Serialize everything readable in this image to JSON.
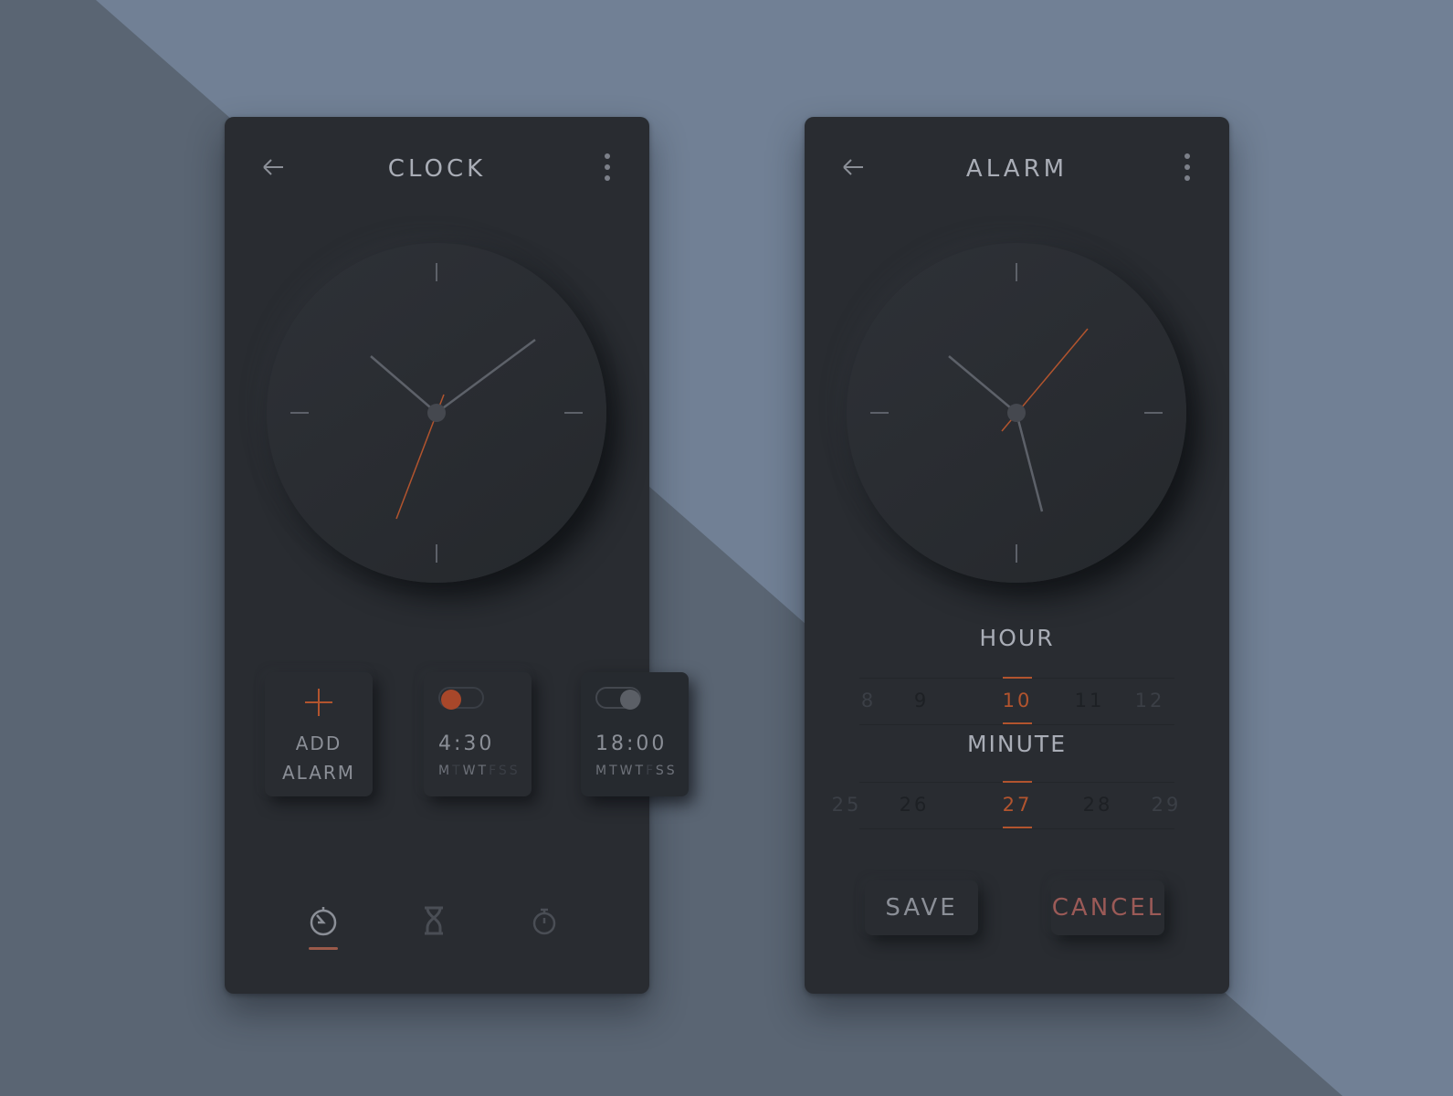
{
  "colors": {
    "background_dark": "#5a6573",
    "background_light": "#718095",
    "panel": "#292c31",
    "accent": "#b2542e",
    "text": "#a9adb6"
  },
  "clock_screen": {
    "title": "CLOCK",
    "back_icon": "arrow-left-icon",
    "menu_icon": "more-vertical-icon",
    "add_alarm": {
      "icon": "plus-icon",
      "line1": "ADD",
      "line2": "ALARM"
    },
    "alarms": [
      {
        "time": "4:30",
        "days": [
          "M",
          "T",
          "W",
          "T",
          "F",
          "S",
          "S"
        ],
        "enabled": true
      },
      {
        "time": "18:00",
        "days": [
          "M",
          "T",
          "W",
          "T",
          "F",
          "S",
          "S"
        ],
        "enabled": false
      }
    ],
    "nav": [
      {
        "name": "clock",
        "icon": "clock-icon",
        "active": true
      },
      {
        "name": "timer",
        "icon": "hourglass-icon",
        "active": false
      },
      {
        "name": "stopwatch",
        "icon": "stopwatch-icon",
        "active": false
      }
    ]
  },
  "alarm_screen": {
    "title": "ALARM",
    "back_icon": "arrow-left-icon",
    "menu_icon": "more-vertical-icon",
    "hour_label": "HOUR",
    "hours": [
      "8",
      "9",
      "10",
      "11",
      "12"
    ],
    "selected_hour": "10",
    "minute_label": "MINUTE",
    "minutes": [
      "25",
      "26",
      "27",
      "28",
      "29"
    ],
    "selected_minute": "27",
    "save_label": "SAVE",
    "cancel_label": "CANCEL"
  }
}
